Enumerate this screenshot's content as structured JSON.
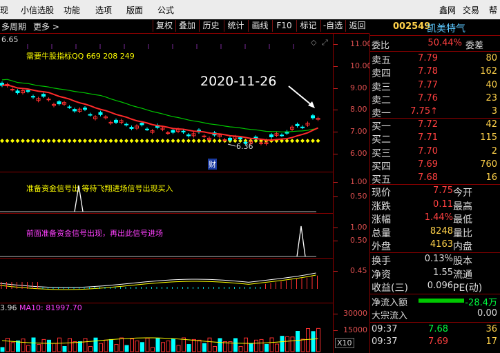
{
  "menu": {
    "items": [
      "现",
      "小信选股",
      "功能",
      "选项",
      "版面",
      "公式"
    ],
    "right_items": [
      "鑫网",
      "交易",
      "帮"
    ]
  },
  "toolbar": {
    "left_items": [
      "多周期",
      "更多 >"
    ],
    "buttons": [
      "复权",
      "叠加",
      "历史",
      "统计",
      "画线",
      "F10",
      "标记",
      "-自选",
      "返回"
    ]
  },
  "main": {
    "price_label": "6.65",
    "promo": "需要牛股指标QQ 669 208 249",
    "date_annotation": "2020-11-26",
    "low_label": "6.36",
    "finance_marker": "财",
    "y_ticks": [
      "11.00",
      "10.00",
      "9.00",
      "8.00",
      "7.00",
      "6.00"
    ]
  },
  "signal1": {
    "text": "准备资金信号出 等待飞翔进场信号出现买入",
    "ticks": [
      "1.00",
      "0.50"
    ]
  },
  "signal2": {
    "text": "前面准备资金信号出现，再出此信号进场",
    "ticks": [
      "1.00",
      "0.50"
    ]
  },
  "macd": {
    "ticks": [
      "0.45"
    ]
  },
  "volume": {
    "label_left": "3.96",
    "label_ma10": "MA10: 81997.70",
    "ticks": [
      "30000",
      "15000"
    ],
    "unit": "X10"
  },
  "quote": {
    "code": "002549",
    "name": "凯美特气",
    "weibi_label": "委比",
    "weibi_value": "50.44%",
    "weicha_label": "委差",
    "sells": [
      {
        "label": "卖五",
        "price": "7.79",
        "vol": "80"
      },
      {
        "label": "卖四",
        "price": "7.78",
        "vol": "162"
      },
      {
        "label": "卖三",
        "price": "7.77",
        "vol": "40"
      },
      {
        "label": "卖二",
        "price": "7.76",
        "vol": "23"
      },
      {
        "label": "卖一",
        "price": "7.75↑",
        "vol": "3"
      }
    ],
    "buys": [
      {
        "label": "买一",
        "price": "7.72",
        "vol": "42"
      },
      {
        "label": "买二",
        "price": "7.71",
        "vol": "115"
      },
      {
        "label": "买三",
        "price": "7.70",
        "vol": "2"
      },
      {
        "label": "买四",
        "price": "7.69",
        "vol": "760"
      },
      {
        "label": "买五",
        "price": "7.68",
        "vol": "16"
      }
    ],
    "stats": [
      {
        "label": "现价",
        "value": "7.75",
        "label2": "今开"
      },
      {
        "label": "涨跌",
        "value": "0.11",
        "label2": "最高"
      },
      {
        "label": "涨幅",
        "value": "1.44%",
        "label2": "最低"
      },
      {
        "label": "总量",
        "value": "8248",
        "label2": "量比"
      },
      {
        "label": "外盘",
        "value": "4163",
        "label2": "内盘"
      }
    ],
    "stats2": [
      {
        "label": "换手",
        "value": "0.13%",
        "label2": "股本"
      },
      {
        "label": "净资",
        "value": "1.55",
        "label2": "流通"
      },
      {
        "label": "收益(三)",
        "value": "0.096",
        "label2": "PE(动)"
      }
    ],
    "netflow_label": "净流入额",
    "netflow_value": "-28.4万",
    "bigflow_label": "大宗流入",
    "bigflow_value": "0.00",
    "ticks": [
      {
        "time": "09:37",
        "price": "7.68",
        "vol": "36"
      },
      {
        "time": "09:37",
        "price": "7.69",
        "vol": "17"
      }
    ]
  },
  "colors": {
    "up": "#ff3030",
    "down": "#00ffff",
    "ma5": "#ffffff",
    "ma10": "#ff2a2a",
    "ma20": "#00c800",
    "yellow": "#ffff00",
    "magenta": "#ff40ff"
  }
}
